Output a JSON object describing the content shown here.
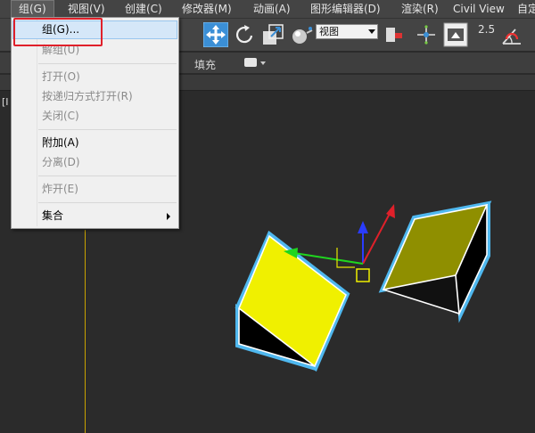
{
  "menubar": {
    "items": [
      {
        "label": "组(G)",
        "active": true
      },
      {
        "label": "视图(V)"
      },
      {
        "label": "创建(C)"
      },
      {
        "label": "修改器(M)"
      },
      {
        "label": "动画(A)"
      },
      {
        "label": "图形编辑器(D)"
      },
      {
        "label": "渲染(R)"
      },
      {
        "label": "Civil View"
      },
      {
        "label": "自定"
      }
    ]
  },
  "toolbar": {
    "view_select": "视图",
    "snap_value": "2.5",
    "icons": [
      "select-move-icon",
      "rotate-icon",
      "scale-icon",
      "render-teapot-icon",
      "pivot-icon",
      "axis-constraint-icon",
      "viewport-icon",
      "snap-angle-icon",
      "magnet-icon"
    ]
  },
  "ribbon": {
    "fill_label": "填充"
  },
  "viewport": {
    "label": "[I"
  },
  "group_menu": {
    "items": [
      {
        "label": "组(G)...",
        "enabled": true,
        "highlighted": true
      },
      {
        "label": "解组(U)",
        "enabled": false
      },
      {
        "separator": true
      },
      {
        "label": "打开(O)",
        "enabled": false
      },
      {
        "label": "按递归方式打开(R)",
        "enabled": false
      },
      {
        "label": "关闭(C)",
        "enabled": false
      },
      {
        "separator": true
      },
      {
        "label": "附加(A)",
        "enabled": true
      },
      {
        "label": "分离(D)",
        "enabled": false
      },
      {
        "separator": true
      },
      {
        "label": "炸开(E)",
        "enabled": false
      },
      {
        "separator": true
      },
      {
        "label": "集合",
        "enabled": true,
        "submenu": true
      }
    ]
  },
  "colors": {
    "menubar_bg": "#444444",
    "viewport_bg": "#2b2b2b",
    "menu_bg": "#f0f0f0",
    "highlight": "#d5e7f8",
    "annotation_red": "#e0202a",
    "object_yellow": "#f0f000",
    "object_olive": "#8f8f00",
    "selection_outline": "#4fb8ef"
  }
}
